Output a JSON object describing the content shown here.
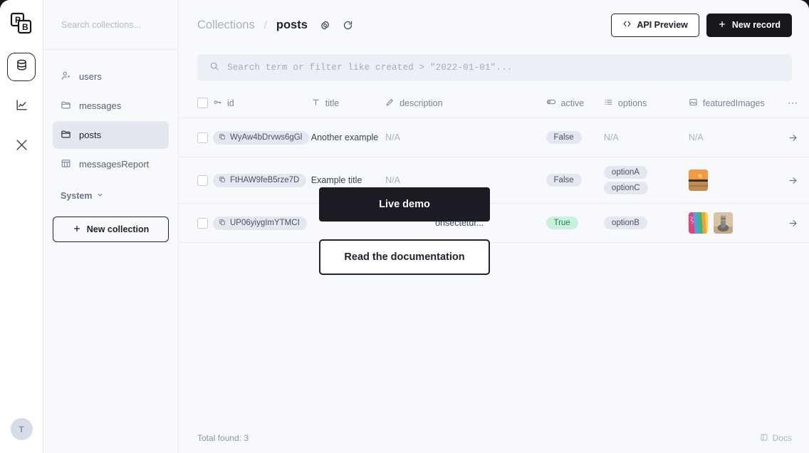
{
  "rail": {
    "logo": "pocketbase-logo",
    "items": [
      {
        "name": "collections",
        "icon": "database-icon",
        "active": true
      },
      {
        "name": "logs",
        "icon": "chart-icon",
        "active": false
      },
      {
        "name": "settings",
        "icon": "tools-icon",
        "active": false
      }
    ],
    "avatar_initial": "T"
  },
  "sidebar": {
    "search_placeholder": "Search collections...",
    "items": [
      {
        "label": "users",
        "icon": "user-icon",
        "active": false
      },
      {
        "label": "messages",
        "icon": "folder-icon",
        "active": false
      },
      {
        "label": "posts",
        "icon": "folder-icon",
        "active": true
      },
      {
        "label": "messagesReport",
        "icon": "table-icon",
        "active": false
      }
    ],
    "system_label": "System",
    "new_collection_label": "New collection"
  },
  "topbar": {
    "breadcrumb_root": "Collections",
    "breadcrumb_sep": "/",
    "breadcrumb_current": "posts",
    "gear_icon": "gear-icon",
    "refresh_icon": "refresh-icon",
    "api_preview_label": "API Preview",
    "new_record_label": "New record"
  },
  "filter": {
    "placeholder": "Search term or filter like created > \"2022-01-01\"..."
  },
  "table": {
    "columns": [
      {
        "key": "id",
        "label": "id",
        "icon": "key-icon"
      },
      {
        "key": "title",
        "label": "title",
        "icon": "text-icon"
      },
      {
        "key": "description",
        "label": "description",
        "icon": "editor-icon"
      },
      {
        "key": "active",
        "label": "active",
        "icon": "toggle-icon"
      },
      {
        "key": "options",
        "label": "options",
        "icon": "list-icon"
      },
      {
        "key": "featuredImages",
        "label": "featuredImages",
        "icon": "image-icon"
      }
    ],
    "more_label": "⋯",
    "rows": [
      {
        "id": "WyAw4bDrvws6gGl",
        "title": "Another example",
        "description": "N/A",
        "description_na": true,
        "active": "False",
        "active_true": false,
        "options": [],
        "options_na": "N/A",
        "images": []
      },
      {
        "id": "FtHAW9feB5rze7D",
        "title": "Example title",
        "description": "N/A",
        "description_na": true,
        "active": "False",
        "active_true": false,
        "options": [
          "optionA",
          "optionC"
        ],
        "options_na": "",
        "images": [
          "sunset-beach-thumbnail"
        ]
      },
      {
        "id": "UP06yiygImYTMCI",
        "title": "",
        "description": "onsectetur...",
        "description_na": false,
        "active": "True",
        "active_true": true,
        "options": [
          "optionB"
        ],
        "options_na": "",
        "images": [
          "rainbow-paint-thumbnail",
          "cat-statue-thumbnail"
        ]
      }
    ]
  },
  "footer": {
    "total_found": "Total found: 3",
    "docs_label": "Docs",
    "docs_icon": "book-icon"
  },
  "overlay": {
    "live_demo_label": "Live demo",
    "read_docs_label": "Read the documentation"
  },
  "colors": {
    "accent_dark": "#16161d",
    "page_bg": "#f8f9fc",
    "badge_true_bg": "#c9f2da",
    "badge_false_bg": "#e3e7ef"
  }
}
